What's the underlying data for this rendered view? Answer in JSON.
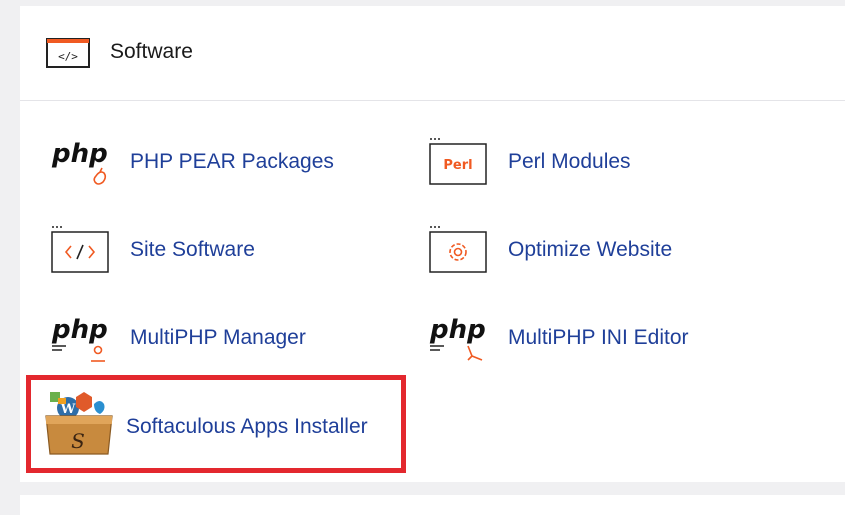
{
  "section": {
    "title": "Software",
    "icon": "code-window-icon"
  },
  "items": [
    {
      "label": "PHP PEAR Packages",
      "icon": "php-pear-icon"
    },
    {
      "label": "Perl Modules",
      "icon": "perl-modules-icon",
      "badge": "Perl"
    },
    {
      "label": "Site Software",
      "icon": "site-software-icon"
    },
    {
      "label": "Optimize Website",
      "icon": "optimize-website-icon"
    },
    {
      "label": "MultiPHP Manager",
      "icon": "multiphp-manager-icon"
    },
    {
      "label": "MultiPHP INI Editor",
      "icon": "multiphp-ini-editor-icon"
    },
    {
      "label": "Softaculous Apps Installer",
      "icon": "softaculous-icon"
    }
  ],
  "php_logo_text": "php",
  "colors": {
    "accent": "#f05a22",
    "link": "#1f3f99",
    "highlight_border": "#e3282e",
    "icon_stroke": "#222222"
  }
}
